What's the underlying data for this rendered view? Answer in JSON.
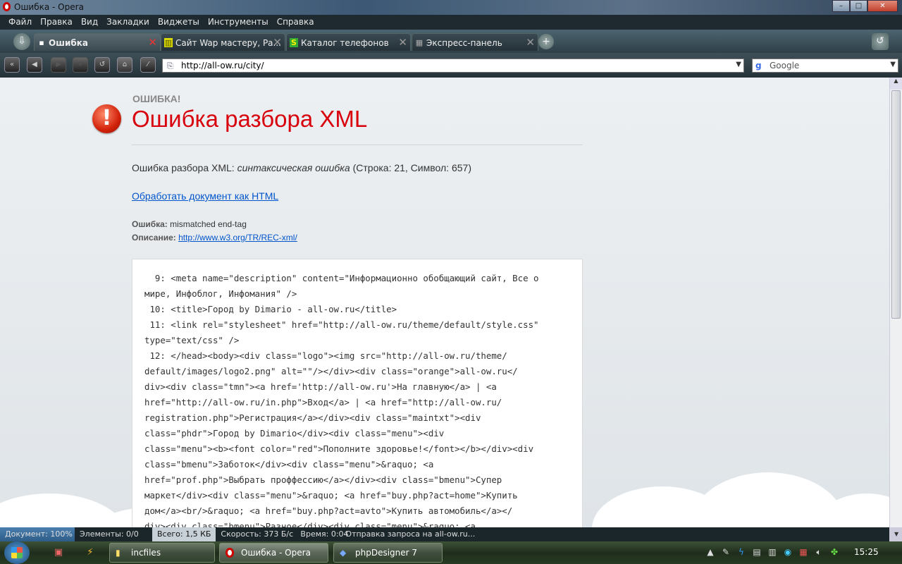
{
  "window": {
    "title": "Ошибка - Opera",
    "min": "–",
    "max": "□",
    "close": "✕"
  },
  "menu": [
    "Файл",
    "Правка",
    "Вид",
    "Закладки",
    "Виджеты",
    "Инструменты",
    "Справка"
  ],
  "tabs": [
    {
      "label": "Ошибка",
      "icon": "page-icon"
    },
    {
      "label": "Сайт Wap мастеру, Ра...",
      "icon": "wap-icon"
    },
    {
      "label": "Каталог телефонов",
      "icon": "s-icon"
    },
    {
      "label": "Экспресс-панель",
      "icon": "grid-icon"
    }
  ],
  "address": {
    "url": "http://all-ow.ru/city/"
  },
  "search": {
    "engine": "Google",
    "g": "g"
  },
  "error": {
    "small_heading": "ОШИБКА!",
    "heading": "Ошибка разбора XML",
    "summary_prefix": "Ошибка разбора XML: ",
    "summary_italic": "синтаксическая ошибка",
    "summary_suffix": " (Строка: 21, Символ: 657)",
    "html_link": "Обработать документ как HTML",
    "error_label": "Ошибка:",
    "error_value": " mismatched end-tag",
    "desc_label": "Описание:",
    "desc_link": "http://www.w3.org/TR/REC-xml/"
  },
  "code_lines": [
    "  9: <meta name=\"description\" content=\"Информационно обобщающий сайт, Все о",
    "мире, Инфоблог, Инфомания\" />",
    " 10: <title>Город by Dimario - all-ow.ru</title>",
    " 11: <link rel=\"stylesheet\" href=\"http://all-ow.ru/theme/default/style.css\"",
    "type=\"text/css\" />",
    " 12: </head><body><div class=\"logo\"><img src=\"http://all-ow.ru/theme/",
    "default/images/logo2.png\" alt=\"\"/></div><div class=\"orange\">all-ow.ru</",
    "div><div class=\"tmn\"><a href='http://all-ow.ru'>На главную</a> | <a",
    "href=\"http://all-ow.ru/in.php\">Вход</a> | <a href=\"http://all-ow.ru/",
    "registration.php\">Регистрация</a></div><div class=\"maintxt\"><div",
    "class=\"phdr\">Город by Dimario</div><div class=\"menu\"><div",
    "class=\"menu\"><b><font color=\"red\">Пополните здоровье!</font></b></div><div",
    "class=\"bmenu\">Заботок</div><div class=\"menu\">&raquo; <a",
    "href=\"prof.php\">Выбрать проффессию</a></div><div class=\"bmenu\">Супер",
    "маркет</div><div class=\"menu\">&raquo; <a href=\"buy.php?act=home\">Купить",
    "дом</a><br/>&raquo; <a href=\"buy.php?act=avto\">Купить автомобиль</a></",
    "div><div class=\"bmenu\">Разное</div><div class=\"menu\">&raquo; <a"
  ],
  "status": {
    "document": "Документ:  100%",
    "elements": "Элементы:  0/0",
    "total": "Всего:  1,5 КБ",
    "speed": "Скорость:  373 Б/с",
    "time": "Время:  0:04",
    "message": "Отправка запроса на all-ow.ru..."
  },
  "taskbar": {
    "items": [
      "incfiles",
      "Ошибка - Opera",
      "phpDesigner 7"
    ],
    "clock": "15:25"
  }
}
